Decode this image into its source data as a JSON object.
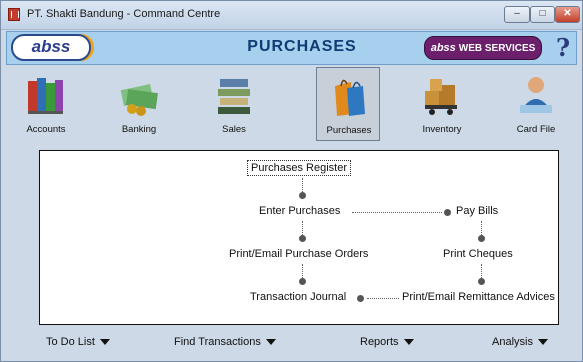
{
  "window": {
    "title": "PT. Shakti Bandung - Command Centre",
    "controls": {
      "minimize": "–",
      "maximize": "□",
      "close": "✕"
    }
  },
  "header": {
    "logo": "abss",
    "module_title": "PURCHASES",
    "web_services_brand": "abss",
    "web_services_label": "WEB SERVICES",
    "help": "?"
  },
  "modules": [
    {
      "label": "Accounts",
      "icon": "accounts-books-icon"
    },
    {
      "label": "Banking",
      "icon": "banking-icon"
    },
    {
      "label": "Sales",
      "icon": "sales-icon"
    },
    {
      "label": "Purchases",
      "icon": "purchases-bags-icon",
      "active": true
    },
    {
      "label": "Inventory",
      "icon": "inventory-icon"
    },
    {
      "label": "Card File",
      "icon": "card-file-icon"
    }
  ],
  "flow": {
    "purchases_register": "Purchases Register",
    "enter_purchases": "Enter Purchases",
    "pay_bills": "Pay Bills",
    "print_email_purchase_orders": "Print/Email Purchase Orders",
    "print_cheques": "Print Cheques",
    "transaction_journal": "Transaction Journal",
    "print_email_remittance": "Print/Email Remittance Advices"
  },
  "bottom": {
    "todo": "To Do List",
    "find": "Find Transactions",
    "reports": "Reports",
    "analysis": "Analysis"
  }
}
